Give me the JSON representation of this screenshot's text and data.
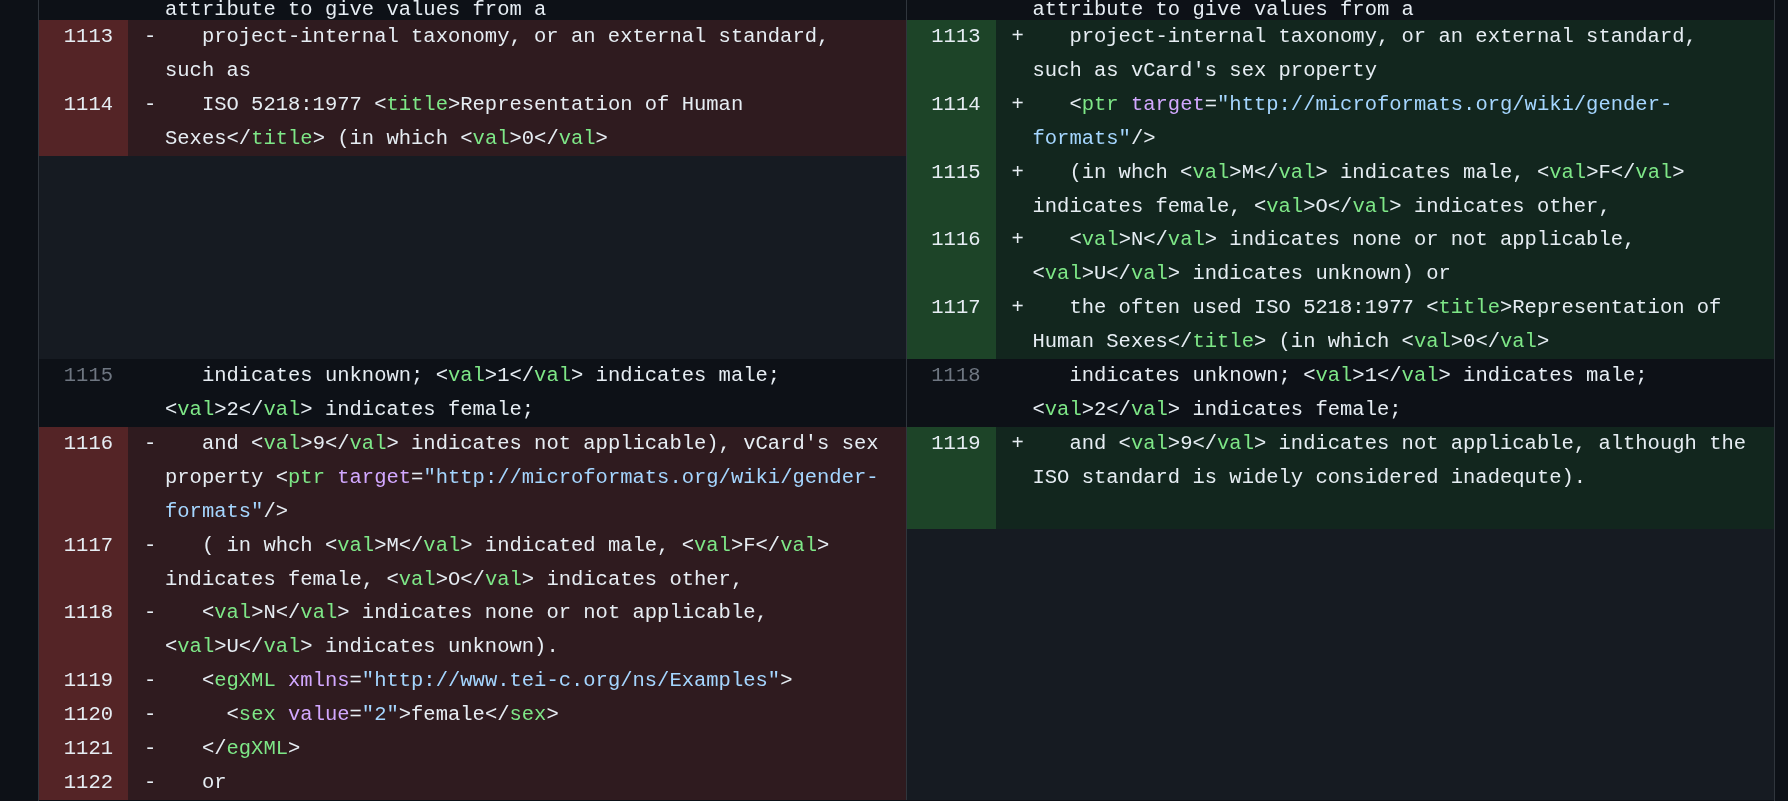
{
  "diff": {
    "rows": [
      {
        "left": {
          "kind": "context",
          "code": [
            {
              "kind": "text",
              "text": "attribute to give values from a"
            }
          ]
        },
        "right": {
          "kind": "context",
          "code": [
            {
              "kind": "text",
              "text": "attribute to give values from a"
            }
          ]
        }
      },
      {
        "left": {
          "kind": "deleted",
          "num": "1113",
          "sign": "-",
          "code": [
            {
              "kind": "text",
              "text": "   project-internal taxonomy, or an external standard, such as"
            }
          ]
        },
        "right": {
          "kind": "added",
          "num": "1113",
          "sign": "+",
          "code": [
            {
              "kind": "text",
              "text": "   project-internal taxonomy, or an external standard, such as vCard's sex property"
            }
          ]
        }
      },
      {
        "left": {
          "kind": "deleted",
          "num": "1114",
          "sign": "-",
          "code": [
            {
              "kind": "text",
              "text": "   ISO 5218:1977 <"
            },
            {
              "kind": "tag",
              "text": "title"
            },
            {
              "kind": "text",
              "text": ">Representation of Human Sexes</"
            },
            {
              "kind": "tag",
              "text": "title"
            },
            {
              "kind": "text",
              "text": "> (in which <"
            },
            {
              "kind": "tag",
              "text": "val"
            },
            {
              "kind": "text",
              "text": ">0</"
            },
            {
              "kind": "tag",
              "text": "val"
            },
            {
              "kind": "text",
              "text": ">"
            }
          ]
        },
        "right": {
          "kind": "added",
          "num": "1114",
          "sign": "+",
          "code": [
            {
              "kind": "text",
              "text": "   <"
            },
            {
              "kind": "tag",
              "text": "ptr"
            },
            {
              "kind": "attr",
              "text": " target"
            },
            {
              "kind": "text",
              "text": "="
            },
            {
              "kind": "string",
              "text": "\"http://microformats.org/wiki/gender-formats\""
            },
            {
              "kind": "text",
              "text": "/>"
            }
          ]
        }
      },
      {
        "right": {
          "kind": "added",
          "num": "1115",
          "sign": "+",
          "code": [
            {
              "kind": "text",
              "text": "   (in whch <"
            },
            {
              "kind": "tag",
              "text": "val"
            },
            {
              "kind": "text",
              "text": ">M</"
            },
            {
              "kind": "tag",
              "text": "val"
            },
            {
              "kind": "text",
              "text": "> indicates male, <"
            },
            {
              "kind": "tag",
              "text": "val"
            },
            {
              "kind": "text",
              "text": ">F</"
            },
            {
              "kind": "tag",
              "text": "val"
            },
            {
              "kind": "text",
              "text": "> indicates female, <"
            },
            {
              "kind": "tag",
              "text": "val"
            },
            {
              "kind": "text",
              "text": ">O</"
            },
            {
              "kind": "tag",
              "text": "val"
            },
            {
              "kind": "text",
              "text": "> indicates other,"
            }
          ]
        }
      },
      {
        "right": {
          "kind": "added",
          "num": "1116",
          "sign": "+",
          "code": [
            {
              "kind": "text",
              "text": "   <"
            },
            {
              "kind": "tag",
              "text": "val"
            },
            {
              "kind": "text",
              "text": ">N</"
            },
            {
              "kind": "tag",
              "text": "val"
            },
            {
              "kind": "text",
              "text": "> indicates none or not applicable, <"
            },
            {
              "kind": "tag",
              "text": "val"
            },
            {
              "kind": "text",
              "text": ">U</"
            },
            {
              "kind": "tag",
              "text": "val"
            },
            {
              "kind": "text",
              "text": "> indicates unknown) or"
            }
          ]
        }
      },
      {
        "right": {
          "kind": "added",
          "num": "1117",
          "sign": "+",
          "code": [
            {
              "kind": "text",
              "text": "   the often used ISO 5218:1977 <"
            },
            {
              "kind": "tag",
              "text": "title"
            },
            {
              "kind": "text",
              "text": ">Representation of Human Sexes</"
            },
            {
              "kind": "tag",
              "text": "title"
            },
            {
              "kind": "text",
              "text": "> (in which <"
            },
            {
              "kind": "tag",
              "text": "val"
            },
            {
              "kind": "text",
              "text": ">0</"
            },
            {
              "kind": "tag",
              "text": "val"
            },
            {
              "kind": "text",
              "text": ">"
            }
          ]
        }
      },
      {
        "left": {
          "kind": "context",
          "num": "1115",
          "code": [
            {
              "kind": "text",
              "text": "   indicates unknown; <"
            },
            {
              "kind": "tag",
              "text": "val"
            },
            {
              "kind": "text",
              "text": ">1</"
            },
            {
              "kind": "tag",
              "text": "val"
            },
            {
              "kind": "text",
              "text": "> indicates male; <"
            },
            {
              "kind": "tag",
              "text": "val"
            },
            {
              "kind": "text",
              "text": ">2</"
            },
            {
              "kind": "tag",
              "text": "val"
            },
            {
              "kind": "text",
              "text": "> indicates female;"
            }
          ]
        },
        "right": {
          "kind": "context",
          "num": "1118",
          "code": [
            {
              "kind": "text",
              "text": "   indicates unknown; <"
            },
            {
              "kind": "tag",
              "text": "val"
            },
            {
              "kind": "text",
              "text": ">1</"
            },
            {
              "kind": "tag",
              "text": "val"
            },
            {
              "kind": "text",
              "text": "> indicates male; <"
            },
            {
              "kind": "tag",
              "text": "val"
            },
            {
              "kind": "text",
              "text": ">2</"
            },
            {
              "kind": "tag",
              "text": "val"
            },
            {
              "kind": "text",
              "text": "> indicates female;"
            }
          ]
        }
      },
      {
        "left": {
          "kind": "deleted",
          "num": "1116",
          "sign": "-",
          "code": [
            {
              "kind": "text",
              "text": "   and <"
            },
            {
              "kind": "tag",
              "text": "val"
            },
            {
              "kind": "text",
              "text": ">9</"
            },
            {
              "kind": "tag",
              "text": "val"
            },
            {
              "kind": "text",
              "text": "> indicates not applicable), vCard's sex property <"
            },
            {
              "kind": "tag",
              "text": "ptr"
            },
            {
              "kind": "attr",
              "text": " target"
            },
            {
              "kind": "text",
              "text": "="
            },
            {
              "kind": "string",
              "text": "\"http://microformats.org/wiki/gender-formats\""
            },
            {
              "kind": "text",
              "text": "/>"
            }
          ]
        },
        "right": {
          "kind": "added",
          "num": "1119",
          "sign": "+",
          "code": [
            {
              "kind": "text",
              "text": "   and <"
            },
            {
              "kind": "tag",
              "text": "val"
            },
            {
              "kind": "text",
              "text": ">9</"
            },
            {
              "kind": "tag",
              "text": "val"
            },
            {
              "kind": "text",
              "text": "> indicates not applicable, although the ISO standard is widely considered inadequte)."
            }
          ]
        }
      },
      {
        "left": {
          "kind": "deleted",
          "num": "1117",
          "sign": "-",
          "code": [
            {
              "kind": "text",
              "text": "   ( in whch <"
            },
            {
              "kind": "tag",
              "text": "val"
            },
            {
              "kind": "text",
              "text": ">M</"
            },
            {
              "kind": "tag",
              "text": "val"
            },
            {
              "kind": "text",
              "text": "> indicated male, <"
            },
            {
              "kind": "tag",
              "text": "val"
            },
            {
              "kind": "text",
              "text": ">F</"
            },
            {
              "kind": "tag",
              "text": "val"
            },
            {
              "kind": "text",
              "text": "> indicates female, <"
            },
            {
              "kind": "tag",
              "text": "val"
            },
            {
              "kind": "text",
              "text": ">O</"
            },
            {
              "kind": "tag",
              "text": "val"
            },
            {
              "kind": "text",
              "text": "> indicates other,"
            }
          ]
        }
      },
      {
        "left": {
          "kind": "deleted",
          "num": "1118",
          "sign": "-",
          "code": [
            {
              "kind": "text",
              "text": "   <"
            },
            {
              "kind": "tag",
              "text": "val"
            },
            {
              "kind": "text",
              "text": ">N</"
            },
            {
              "kind": "tag",
              "text": "val"
            },
            {
              "kind": "text",
              "text": "> indicates none or not applicable, <"
            },
            {
              "kind": "tag",
              "text": "val"
            },
            {
              "kind": "text",
              "text": ">U</"
            },
            {
              "kind": "tag",
              "text": "val"
            },
            {
              "kind": "text",
              "text": "> indicates unknown)."
            }
          ]
        }
      },
      {
        "left": {
          "kind": "deleted",
          "num": "1119",
          "sign": "-",
          "code": [
            {
              "kind": "text",
              "text": "   <"
            },
            {
              "kind": "tag",
              "text": "egXML"
            },
            {
              "kind": "attr",
              "text": " xmlns"
            },
            {
              "kind": "text",
              "text": "="
            },
            {
              "kind": "string",
              "text": "\"http://www.tei-c.org/ns/Examples\""
            },
            {
              "kind": "text",
              "text": ">"
            }
          ]
        }
      },
      {
        "left": {
          "kind": "deleted",
          "num": "1120",
          "sign": "-",
          "code": [
            {
              "kind": "text",
              "text": "     <"
            },
            {
              "kind": "tag",
              "text": "sex"
            },
            {
              "kind": "attr",
              "text": " value"
            },
            {
              "kind": "text",
              "text": "="
            },
            {
              "kind": "string",
              "text": "\"2\""
            },
            {
              "kind": "text",
              "text": ">female</"
            },
            {
              "kind": "tag",
              "text": "sex"
            },
            {
              "kind": "text",
              "text": ">"
            }
          ]
        }
      },
      {
        "left": {
          "kind": "deleted",
          "num": "1121",
          "sign": "-",
          "code": [
            {
              "kind": "text",
              "text": "   </"
            },
            {
              "kind": "tag",
              "text": "egXML"
            },
            {
              "kind": "text",
              "text": ">"
            }
          ]
        }
      },
      {
        "left": {
          "kind": "deleted",
          "num": "1122",
          "sign": "-",
          "code": [
            {
              "kind": "text",
              "text": "   or"
            }
          ]
        }
      }
    ]
  }
}
